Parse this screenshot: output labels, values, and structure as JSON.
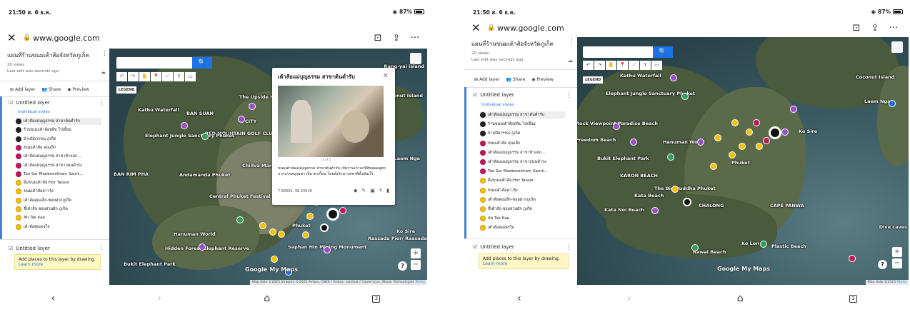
{
  "left": {
    "status": {
      "time": "21:50 ส. 6 ธ.ค.",
      "battery": "87%"
    },
    "browser": {
      "close": "✕",
      "lock": "🔒",
      "url": "www.google.com",
      "bookmark": "⊡",
      "share": "⇪",
      "more": "···"
    },
    "panel": {
      "map_title": "แผนที่ร้านขนมเต้าส้อจังหวัดภูเก็ต",
      "views": "20 views",
      "last_edit": "Last edit was seconds ago",
      "add_layer": "Add layer",
      "share": "Share",
      "preview": "Preview",
      "layer1": "Untitled layer",
      "individual_styles": "Individual styles",
      "items": [
        {
          "label": "เต้าส้อแม่บุญธรรม สาขาต้นต่ำรับ",
          "color": "k"
        },
        {
          "label": "ร้านขนมเต้าส้อหลิม ไป่เอี้ยม",
          "color": "k"
        },
        {
          "label": "บ้านปิยวรรณ ภูเก็ต",
          "color": "k"
        },
        {
          "label": "ขนมเต้าส้อ คุณเล็ก",
          "color": "p"
        },
        {
          "label": "เต้าส้อแม่บุญธรรม สาขาห้าแยก...",
          "color": "p"
        },
        {
          "label": "เต้าส้อแม่บุญธรรม สาขาถนนดำรง",
          "color": "p"
        },
        {
          "label": "Tao Sor Maeboontham Samk...",
          "color": "p"
        },
        {
          "label": "อิ่มขนมเต้าส้อ:Hor Taosor",
          "color": "y"
        },
        {
          "label": "ขนมเต้าส้อดาวรุ้ง",
          "color": "y"
        },
        {
          "label": "เต้าส้อคุณเล็ก-ซอยฝากภูเก็ต",
          "color": "y"
        },
        {
          "label": "ชี้เต้าส้อ ซอยสวนผัก ภูเก็ต",
          "color": "y"
        },
        {
          "label": "Ah Tak Kae",
          "color": "y"
        },
        {
          "label": "เต้าส้อคุณพรใจ",
          "color": "y"
        }
      ],
      "layer2": "Untitled layer",
      "hint": "Add places to this layer by drawing.",
      "learn_more": "Learn more"
    },
    "map": {
      "legend": "LEGEND",
      "search_icon": "🔍",
      "labels": [
        "Rang-yai island",
        "Kathu Waterfall",
        "BAN SUAN",
        "CITY",
        "RED MOUNTAIN GOLF CLUB",
        "Elephant Jungle Sanctuary Phuket",
        "BAN RIM PHA",
        "Andamanda Phuket",
        "Chillva Market",
        "Central Phuket Festival",
        "Phuket",
        "Hanuman World",
        "Hidden Forest Elephant Reserve",
        "Bukit Elephant Park",
        "Saphan Hin Mining Monument",
        "Rassada Pier/ Rassada Harbour",
        "Ko Sire",
        "The Upside House Museum",
        "Coconut Island",
        "Laem Nga"
      ],
      "attribution": "Map data ©2025 Imagery ©2025 Airbus, CNES / Airbus, Landsat / Copernicus, Maxar Technologies",
      "terms": "Terms",
      "brand": "Google My Maps"
    },
    "popup": {
      "title": "เต้าส้อแม่บุญธรรม สาขาต้นต่ำรับ",
      "close": "✕",
      "count": "1 of 1",
      "desc": "ขนมเต้าส้อแม่บุญธรรม สาขาต้นต่ำรับ เป็นร้านเก่าแก่ที่สืบทอดสูตรจากบรรพบุรุษชาวจีน ฮกเกี้ยน โดยยังรักษารสชาติดั้งเดิมไว้",
      "coord": "7.88682, 98.39918"
    }
  },
  "right": {
    "status": {
      "time": "21:50 ส. 6 ธ.ค.",
      "battery": "87%"
    },
    "browser": {
      "close": "✕",
      "lock": "🔒",
      "url": "www.google.com"
    },
    "map": {
      "labels": [
        "Kathu Waterfall",
        "Elephant Jungle Sanctuary Phuket",
        "Coconut Island",
        "Laem Nga",
        "Rock Viewpoint Paradise Beach",
        "Freedom Beach",
        "Hanuman World",
        "Ko Sire",
        "Bukit Elephant Park",
        "The Big Buddha Phuket",
        "Kata Noi Beach",
        "Kata Beach",
        "Ko Lon",
        "Rawai Beach",
        "Plastic Beach",
        "Dive caves",
        "Phuket",
        "CAPE PANWA",
        "KARON BEACH",
        "CHALONG"
      ],
      "attribution": "Map data ©2025",
      "terms": "Terms"
    }
  },
  "nav": {
    "back": "‹",
    "forward": "›",
    "home": "⌂",
    "tabs": "3"
  }
}
